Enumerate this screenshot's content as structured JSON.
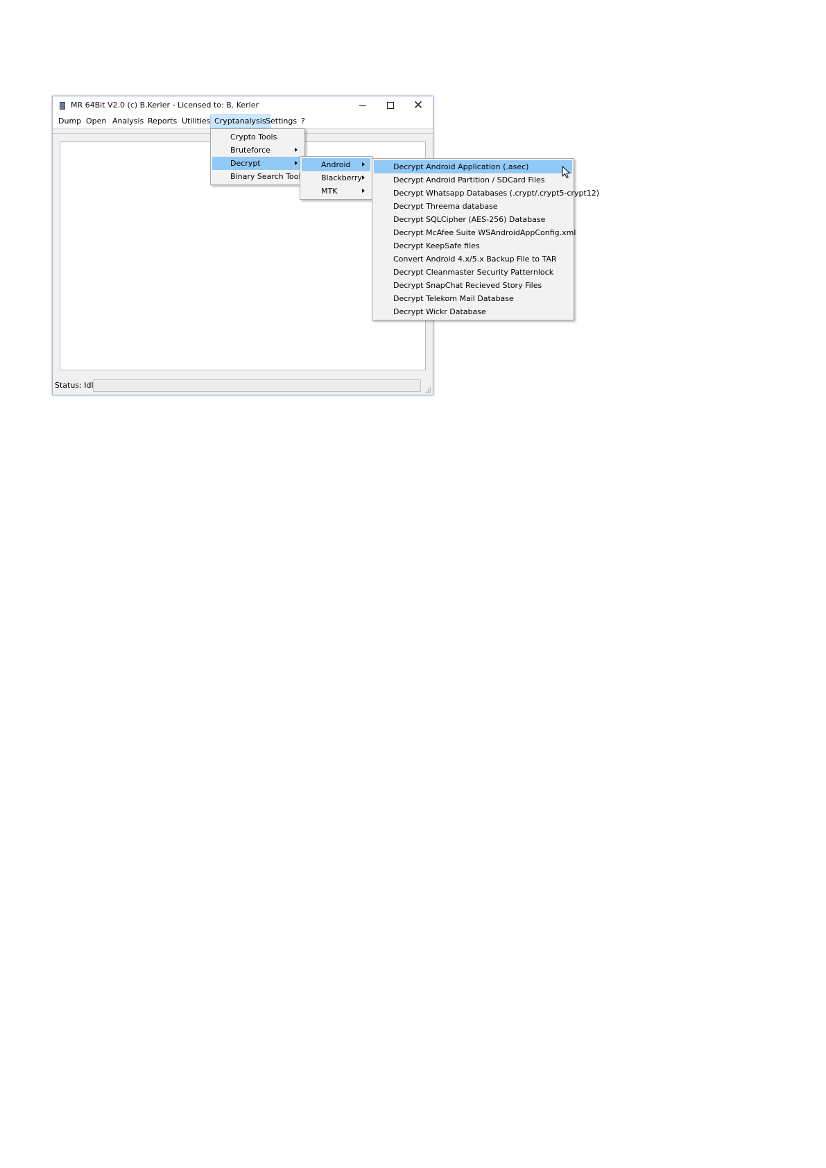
{
  "window": {
    "title": "MR 64Bit V2.0 (c) B.Kerler - Licensed to: B. Kerler",
    "controls": {
      "minimize": "minimize-icon",
      "maximize": "maximize-icon",
      "close": "close-icon"
    }
  },
  "menubar": {
    "items": [
      "Dump",
      "Open",
      "Analysis",
      "Reports",
      "Utilities",
      "Cryptanalysis",
      "Settings",
      "?"
    ],
    "active": "Cryptanalysis"
  },
  "cryptanalysis_menu": {
    "items": [
      {
        "label": "Crypto Tools",
        "submenu": false
      },
      {
        "label": "Bruteforce",
        "submenu": true
      },
      {
        "label": "Decrypt",
        "submenu": true,
        "highlighted": true
      },
      {
        "label": "Binary Search Tool",
        "submenu": false
      }
    ]
  },
  "decrypt_menu": {
    "items": [
      {
        "label": "Android",
        "submenu": true,
        "highlighted": true
      },
      {
        "label": "Blackberry",
        "submenu": true
      },
      {
        "label": "MTK",
        "submenu": true
      }
    ]
  },
  "android_menu": {
    "items": [
      {
        "label": "Decrypt Android Application (.asec)",
        "highlighted": true
      },
      {
        "label": "Decrypt Android Partition / SDCard Files"
      },
      {
        "label": "Decrypt Whatsapp Databases (.crypt/.crypt5-crypt12)"
      },
      {
        "label": "Decrypt Threema database"
      },
      {
        "label": "Decrypt SQLCipher (AES-256) Database"
      },
      {
        "label": "Decrypt McAfee Suite WSAndroidAppConfig.xml"
      },
      {
        "label": "Decrypt KeepSafe files"
      },
      {
        "label": "Convert Android 4.x/5.x Backup File to TAR"
      },
      {
        "label": "Decrypt Cleanmaster Security Patternlock"
      },
      {
        "label": "Decrypt SnapChat Recieved Story Files"
      },
      {
        "label": "Decrypt Telekom Mail Database"
      },
      {
        "label": "Decrypt Wickr Database"
      }
    ]
  },
  "statusbar": {
    "label": "Status: Idle."
  },
  "colors": {
    "highlight": "#91c9f7",
    "menubar_active": "#cce8ff",
    "window_border": "#9bb7d9"
  }
}
